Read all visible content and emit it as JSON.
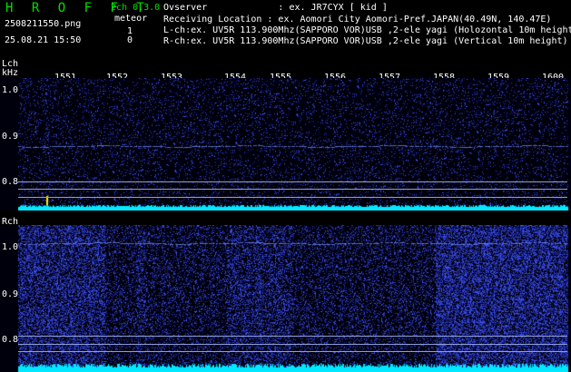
{
  "header": {
    "app_title": "H R O F F T",
    "version": "2ch 0.3.0",
    "meteor_label": "meteor",
    "filename": "2508211550.png",
    "datetime": "25.08.21 15:50",
    "lch_count": "1",
    "rch_count": "0",
    "observer_line": "Ovserver             : ex. JR7CYX [ kid ]",
    "location_line": "Receiving Location : ex. Aomori City Aomori-Pref.JAPAN(40.49N, 140.47E)",
    "lch_line": "L-ch:ex. UV5R 113.900Mhz(SAPPORO VOR)USB ,2-ele yagi (Holozontal 10m height)",
    "rch_line": "R-ch:ex. UV5R 113.900Mhz(SAPPORO VOR)USB ,2-ele yagi (Vertical 10m height)"
  },
  "lch": {
    "label": "Lch",
    "unit": "kHz",
    "y_ticks": [
      "1.0",
      "0.9",
      "0.8"
    ]
  },
  "rch": {
    "label": "Rch",
    "y_ticks": [
      "1.0",
      "0.9",
      "0.8"
    ]
  },
  "time_axis": {
    "ticks": [
      "1551",
      "1552",
      "1553",
      "1554",
      "1555",
      "1556",
      "1557",
      "1558",
      "1559",
      "1600"
    ]
  },
  "colors": {
    "background": "#000000",
    "text": "#ffffff",
    "title_green": "#00e000",
    "noise_blue": "#2030c0",
    "signal_cyan": "#00e8ff",
    "grid_line": "#8ea0d8"
  }
}
